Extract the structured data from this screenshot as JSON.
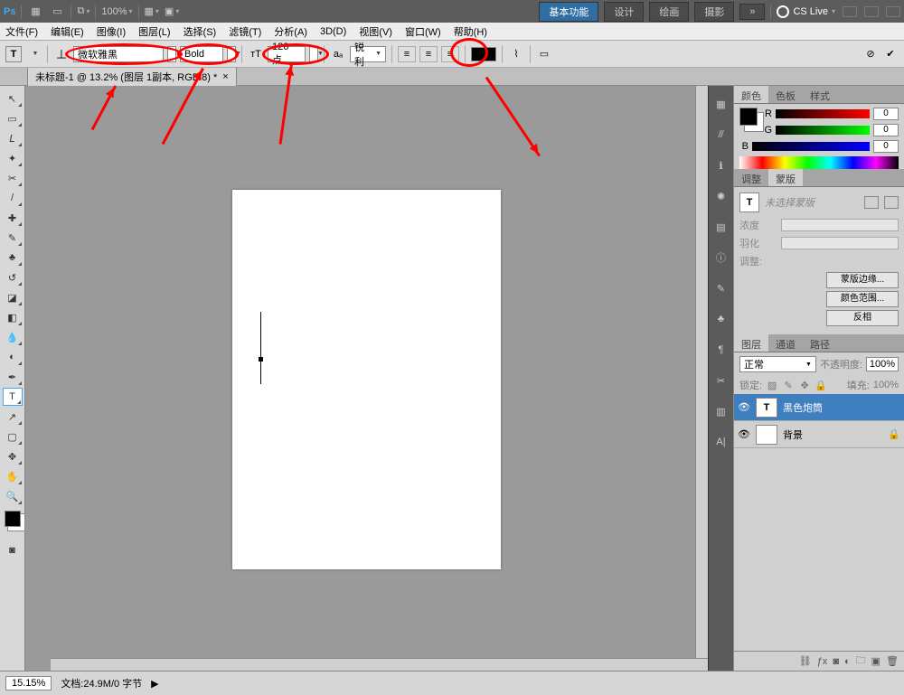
{
  "topbar": {
    "ps_label": "Ps",
    "zoom_dropdown": "100%",
    "workspace_buttons": [
      "基本功能",
      "设计",
      "绘画",
      "摄影"
    ],
    "cslive": "CS Live"
  },
  "menu": [
    "文件(F)",
    "编辑(E)",
    "图像(I)",
    "图层(L)",
    "选择(S)",
    "滤镜(T)",
    "分析(A)",
    "3D(D)",
    "视图(V)",
    "窗口(W)",
    "帮助(H)"
  ],
  "optbar": {
    "tool_label": "T",
    "font_family": "微软雅黑",
    "font_style": "Bold",
    "font_size": "120 点",
    "aa_prefix": "aₐ",
    "aa_mode": "锐利"
  },
  "doc_tab": "未标题-1 @ 13.2% (图层 1副本, RGB/8) *",
  "color_panel_tabs": [
    "颜色",
    "色板",
    "样式"
  ],
  "rgb": {
    "r": "0",
    "g": "0",
    "b": "0"
  },
  "adjust_tabs": [
    "调整",
    "蒙版"
  ],
  "mask": {
    "thumb_char": "T",
    "placeholder": "未选择蒙版",
    "density_label": "浓度",
    "feather_label": "羽化",
    "refine_label": "调整:",
    "btn_edge": "蒙版边缘...",
    "btn_range": "颜色范围...",
    "btn_invert": "反相"
  },
  "layers_tabs": [
    "图层",
    "通道",
    "路径"
  ],
  "layers": {
    "blend_mode": "正常",
    "opacity_label": "不透明度:",
    "opacity_value": "100%",
    "lock_label": "锁定:",
    "fill_label": "填充:",
    "fill_value": "100%",
    "rows": [
      {
        "thumb": "T",
        "name": "黑色炮筒",
        "selected": true
      },
      {
        "thumb": "",
        "name": "背景",
        "locked": true
      }
    ]
  },
  "status": {
    "zoom": "15.15%",
    "doc": "文档:24.9M/0 字节"
  },
  "dock_icons": [
    "nav-icon",
    "histogram-icon",
    "info-icon",
    "flare-icon",
    "swatches-icon",
    "type-icon",
    "brush-icon",
    "clone-icon",
    "paragraph-icon",
    "tools-icon",
    "measure-icon",
    "character-icon"
  ],
  "tools": [
    "move",
    "marquee",
    "lasso",
    "wand",
    "crop",
    "eyedropper",
    "heal",
    "brush",
    "stamp",
    "history",
    "eraser",
    "gradient",
    "blur",
    "dodge",
    "pen",
    "text",
    "path",
    "shape",
    "view3d",
    "hand",
    "zoom"
  ]
}
